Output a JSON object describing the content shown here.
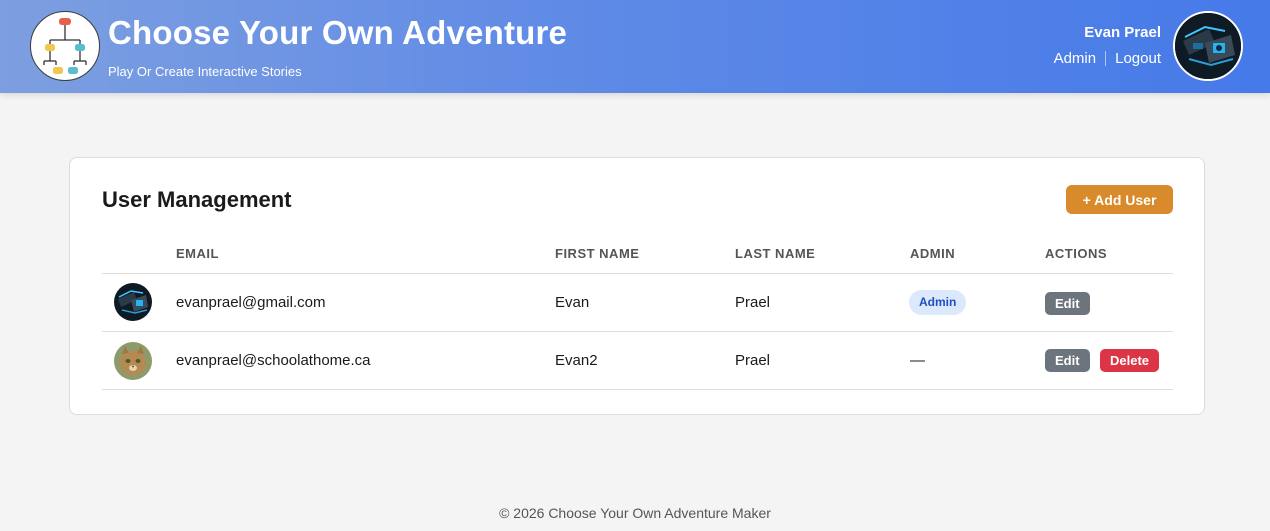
{
  "header": {
    "title": "Choose Your Own Adventure",
    "subtitle": "Play Or Create Interactive Stories",
    "user_name": "Evan Prael",
    "admin_link": "Admin",
    "logout_link": "Logout",
    "logo_icon": "flowchart-icon",
    "avatar_icon": "robot-avatar-icon"
  },
  "card": {
    "title": "User Management",
    "add_button": "+ Add User",
    "columns": [
      "EMAIL",
      "FIRST NAME",
      "LAST NAME",
      "ADMIN",
      "ACTIONS"
    ],
    "rows": [
      {
        "avatar": "robot-avatar-icon",
        "email": "evanprael@gmail.com",
        "first_name": "Evan",
        "last_name": "Prael",
        "admin": "Admin",
        "edit": "Edit"
      },
      {
        "avatar": "cat-avatar-icon",
        "email": "evanprael@schoolathome.ca",
        "first_name": "Evan2",
        "last_name": "Prael",
        "admin": "—",
        "edit": "Edit",
        "delete": "Delete"
      }
    ]
  },
  "footer": {
    "text": "© 2026 Choose Your Own Adventure Maker"
  },
  "colors": {
    "header_start": "#7d9fe0",
    "header_end": "#467ae9",
    "add_button": "#d98a2b",
    "edit_button": "#6c757d",
    "delete_button": "#dc3545",
    "admin_badge_bg": "#dce8fb",
    "admin_badge_text": "#1f4fbf"
  }
}
